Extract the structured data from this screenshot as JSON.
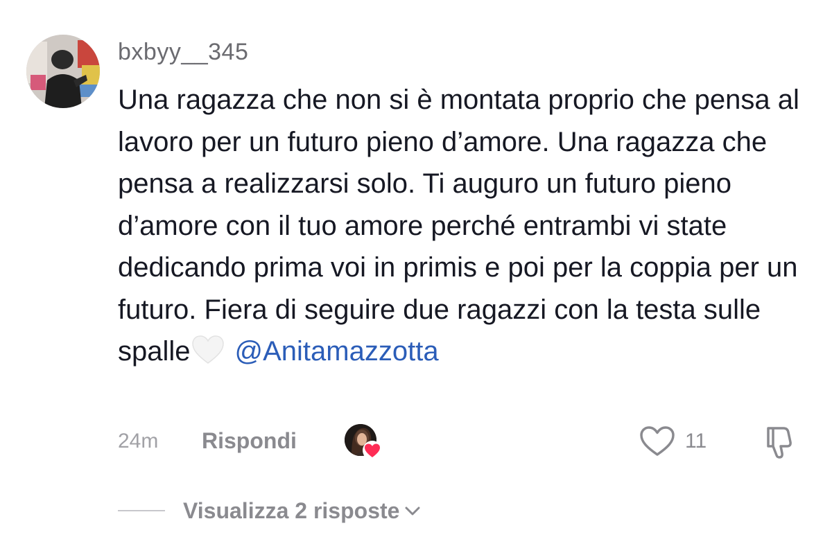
{
  "comment": {
    "username": "bxbyy__345",
    "text": "Una ragazza che non si è montata proprio che pensa al lavoro per un futuro pieno d’amore. Una ragazza che pensa a realizzarsi solo. Ti auguro un futuro pieno d’amore con il tuo amore perché entrambi vi state dedicando prima voi in primis e poi per la coppia per un futuro. Fiera di seguire due ragazzi con la testa sulle spalle",
    "emoji": "white-heart",
    "mention": "@Anitamazzotta",
    "time": "24m",
    "reply_label": "Rispondi",
    "like_count": "11",
    "creator_liked": true,
    "view_replies_label": "Visualizza 2 risposte"
  },
  "colors": {
    "mention": "#2b5db8",
    "creator_heart": "#fe2c55",
    "muted_text": "#8a8a8f"
  },
  "icons": {
    "like": "heart-outline-icon",
    "dislike": "thumbs-down-icon",
    "expand": "chevron-down-icon"
  }
}
